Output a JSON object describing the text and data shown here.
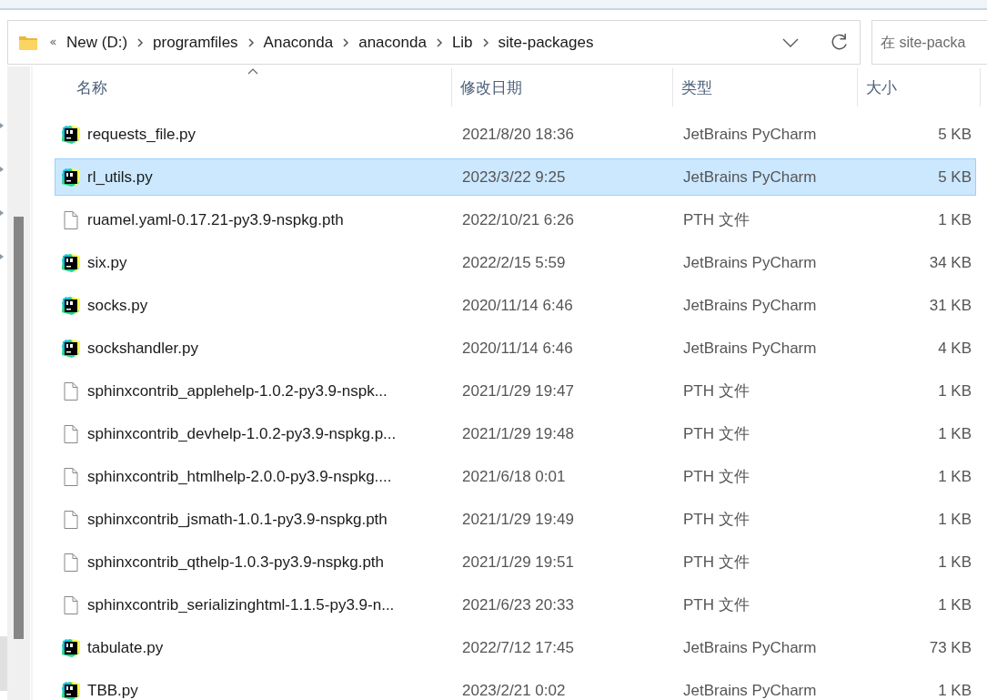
{
  "address_bar": {
    "breadcrumbs": [
      "New (D:)",
      "programfiles",
      "Anaconda",
      "anaconda",
      "Lib",
      "site-packages"
    ]
  },
  "search": {
    "placeholder": "在 site-packa"
  },
  "columns": [
    {
      "label": "名称",
      "sorted": true
    },
    {
      "label": "修改日期",
      "sorted": false
    },
    {
      "label": "类型",
      "sorted": false
    },
    {
      "label": "大小",
      "sorted": false
    }
  ],
  "rows": [
    {
      "kind": "pycharm",
      "name": "requests_file.py",
      "modified": "2021/8/20 18:36",
      "type": "JetBrains PyCharm",
      "size": "5 KB",
      "selected": false
    },
    {
      "kind": "pycharm",
      "name": "rl_utils.py",
      "modified": "2023/3/22 9:25",
      "type": "JetBrains PyCharm",
      "size": "5 KB",
      "selected": true
    },
    {
      "kind": "file",
      "name": "ruamel.yaml-0.17.21-py3.9-nspkg.pth",
      "modified": "2022/10/21 6:26",
      "type": "PTH 文件",
      "size": "1 KB",
      "selected": false
    },
    {
      "kind": "pycharm",
      "name": "six.py",
      "modified": "2022/2/15 5:59",
      "type": "JetBrains PyCharm",
      "size": "34 KB",
      "selected": false
    },
    {
      "kind": "pycharm",
      "name": "socks.py",
      "modified": "2020/11/14 6:46",
      "type": "JetBrains PyCharm",
      "size": "31 KB",
      "selected": false
    },
    {
      "kind": "pycharm",
      "name": "sockshandler.py",
      "modified": "2020/11/14 6:46",
      "type": "JetBrains PyCharm",
      "size": "4 KB",
      "selected": false
    },
    {
      "kind": "file",
      "name": "sphinxcontrib_applehelp-1.0.2-py3.9-nspk...",
      "modified": "2021/1/29 19:47",
      "type": "PTH 文件",
      "size": "1 KB",
      "selected": false
    },
    {
      "kind": "file",
      "name": "sphinxcontrib_devhelp-1.0.2-py3.9-nspkg.p...",
      "modified": "2021/1/29 19:48",
      "type": "PTH 文件",
      "size": "1 KB",
      "selected": false
    },
    {
      "kind": "file",
      "name": "sphinxcontrib_htmlhelp-2.0.0-py3.9-nspkg....",
      "modified": "2021/6/18 0:01",
      "type": "PTH 文件",
      "size": "1 KB",
      "selected": false
    },
    {
      "kind": "file",
      "name": "sphinxcontrib_jsmath-1.0.1-py3.9-nspkg.pth",
      "modified": "2021/1/29 19:49",
      "type": "PTH 文件",
      "size": "1 KB",
      "selected": false
    },
    {
      "kind": "file",
      "name": "sphinxcontrib_qthelp-1.0.3-py3.9-nspkg.pth",
      "modified": "2021/1/29 19:51",
      "type": "PTH 文件",
      "size": "1 KB",
      "selected": false
    },
    {
      "kind": "file",
      "name": "sphinxcontrib_serializinghtml-1.1.5-py3.9-n...",
      "modified": "2021/6/23 20:33",
      "type": "PTH 文件",
      "size": "1 KB",
      "selected": false
    },
    {
      "kind": "pycharm",
      "name": "tabulate.py",
      "modified": "2022/7/12 17:45",
      "type": "JetBrains PyCharm",
      "size": "73 KB",
      "selected": false
    },
    {
      "kind": "pycharm",
      "name": "TBB.py",
      "modified": "2023/2/21 0:02",
      "type": "JetBrains PyCharm",
      "size": "1 KB",
      "selected": false
    }
  ]
}
